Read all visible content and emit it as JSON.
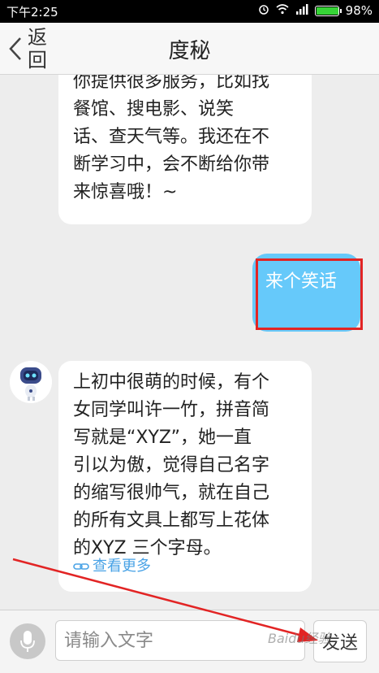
{
  "status_bar": {
    "time": "下午2:25",
    "battery": "98%",
    "battery_level": 0.98,
    "icons": [
      "alarm-icon",
      "wifi-icon",
      "signal-icon",
      "battery-icon"
    ]
  },
  "header": {
    "back_label": "返回",
    "title": "度秘"
  },
  "chat": {
    "messages": [
      {
        "side": "left",
        "text": "你提供很多服务，比如找\n餐馆、搜电影、说笑\n话、查天气等。我还在不\n断学习中，会不断给你带\n来惊喜哦！~"
      },
      {
        "side": "right",
        "text": "来个笑话"
      },
      {
        "side": "left",
        "text": "上初中很萌的时候，有个\n女同学叫许一竹，拼音简\n写就是“XYZ”，她一直\n引以为傲，觉得自己名字\n的缩写很帅气，就在自己\n的所有文具上都写上花体\n的XYZ 三个字母。",
        "link_label": "查看更多"
      }
    ]
  },
  "input_bar": {
    "placeholder": "请输入文字",
    "send_label": "发送"
  },
  "watermark": "Baidu经验",
  "colors": {
    "bubble_user": "#66c9fa",
    "link": "#4aa3e6",
    "highlight": "#e22424"
  }
}
